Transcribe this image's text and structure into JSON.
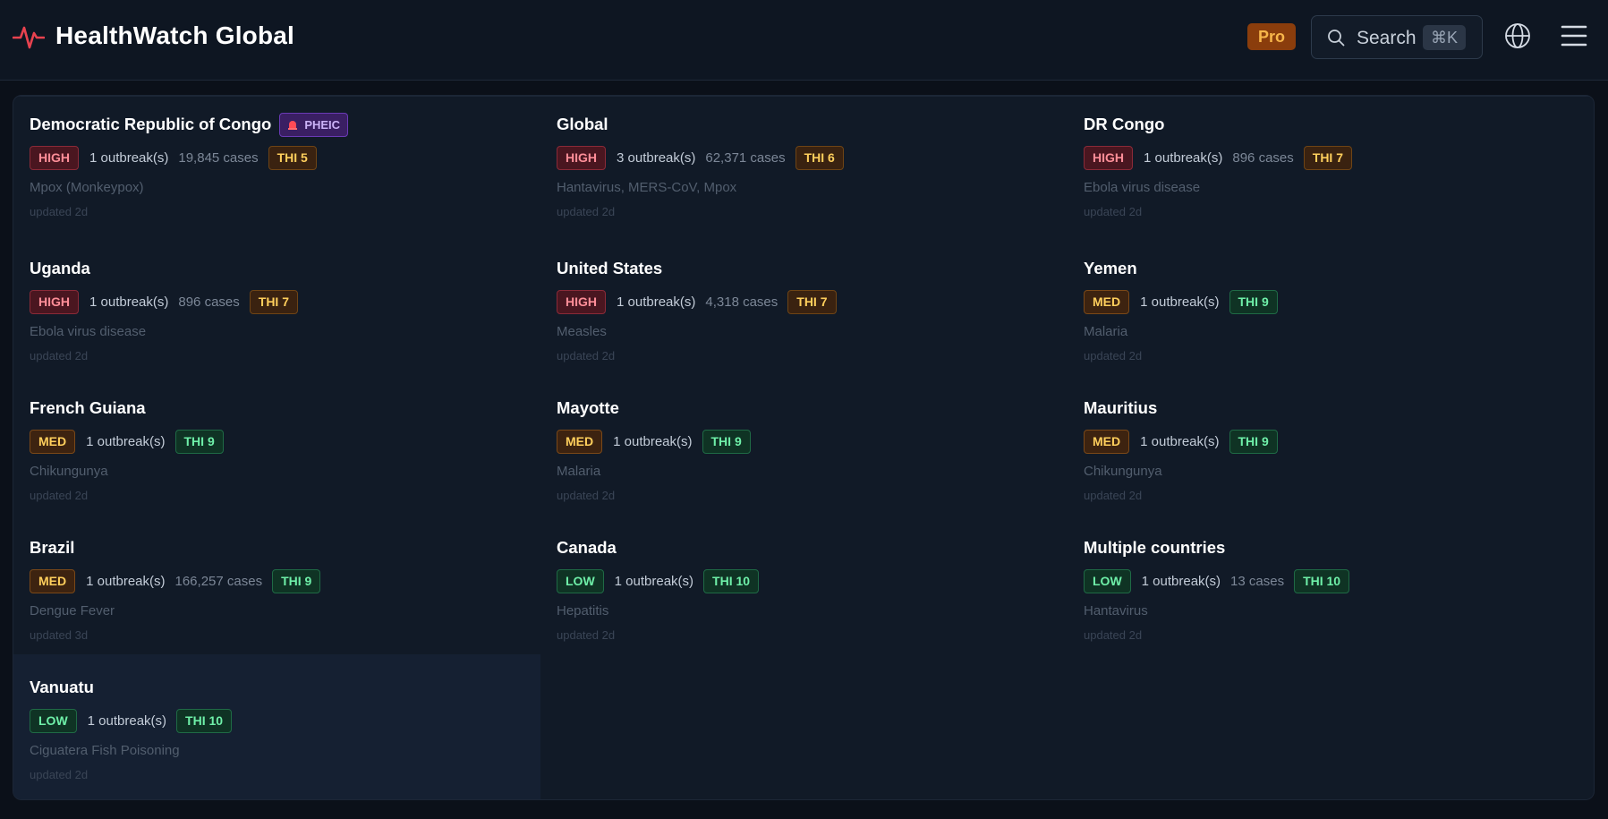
{
  "app": {
    "title": "HealthWatch Global"
  },
  "header": {
    "pro_label": "Pro",
    "search_label": "Search",
    "search_shortcut": "⌘K"
  },
  "colors": {
    "accent_logo": "#e8424f",
    "high": "#ff8e98",
    "med": "#ffcf5c",
    "low": "#6ff0a9"
  },
  "icons": {
    "logo": "heartbeat-pulse-icon",
    "search": "search-icon",
    "language": "globe-icon",
    "menu": "hamburger-menu-icon",
    "pheic": "alarm-siren-icon"
  },
  "outbreaks": [
    {
      "country": "Democratic Republic of Congo",
      "pheic": "PHEIC",
      "severity": "HIGH",
      "outbreak_count": "1 outbreak(s)",
      "cases": "19,845 cases",
      "thi": "THI 5",
      "disease": "Mpox (Monkeypox)",
      "updated": "updated 2d"
    },
    {
      "country": "Global",
      "severity": "HIGH",
      "outbreak_count": "3 outbreak(s)",
      "cases": "62,371 cases",
      "thi": "THI 6",
      "disease": "Hantavirus, MERS-CoV, Mpox",
      "updated": "updated 2d"
    },
    {
      "country": "DR Congo",
      "severity": "HIGH",
      "outbreak_count": "1 outbreak(s)",
      "cases": "896 cases",
      "thi": "THI 7",
      "disease": "Ebola virus disease",
      "updated": "updated 2d"
    },
    {
      "country": "Uganda",
      "severity": "HIGH",
      "outbreak_count": "1 outbreak(s)",
      "cases": "896 cases",
      "thi": "THI 7",
      "disease": "Ebola virus disease",
      "updated": "updated 2d"
    },
    {
      "country": "United States",
      "severity": "HIGH",
      "outbreak_count": "1 outbreak(s)",
      "cases": "4,318 cases",
      "thi": "THI 7",
      "disease": "Measles",
      "updated": "updated 2d"
    },
    {
      "country": "Yemen",
      "severity": "MED",
      "outbreak_count": "1 outbreak(s)",
      "cases": "",
      "thi": "THI 9",
      "disease": "Malaria",
      "updated": "updated 2d"
    },
    {
      "country": "French Guiana",
      "severity": "MED",
      "outbreak_count": "1 outbreak(s)",
      "cases": "",
      "thi": "THI 9",
      "disease": "Chikungunya",
      "updated": "updated 2d"
    },
    {
      "country": "Mayotte",
      "severity": "MED",
      "outbreak_count": "1 outbreak(s)",
      "cases": "",
      "thi": "THI 9",
      "disease": "Malaria",
      "updated": "updated 2d"
    },
    {
      "country": "Mauritius",
      "severity": "MED",
      "outbreak_count": "1 outbreak(s)",
      "cases": "",
      "thi": "THI 9",
      "disease": "Chikungunya",
      "updated": "updated 2d"
    },
    {
      "country": "Brazil",
      "severity": "MED",
      "outbreak_count": "1 outbreak(s)",
      "cases": "166,257 cases",
      "thi": "THI 9",
      "disease": "Dengue Fever",
      "updated": "updated 3d"
    },
    {
      "country": "Canada",
      "severity": "LOW",
      "outbreak_count": "1 outbreak(s)",
      "cases": "",
      "thi": "THI 10",
      "disease": "Hepatitis",
      "updated": "updated 2d"
    },
    {
      "country": "Multiple countries",
      "severity": "LOW",
      "outbreak_count": "1 outbreak(s)",
      "cases": "13 cases",
      "thi": "THI 10",
      "disease": "Hantavirus",
      "updated": "updated 2d"
    },
    {
      "country": "Vanuatu",
      "severity": "LOW",
      "outbreak_count": "1 outbreak(s)",
      "cases": "",
      "thi": "THI 10",
      "disease": "Ciguatera Fish Poisoning",
      "updated": "updated 2d"
    }
  ]
}
